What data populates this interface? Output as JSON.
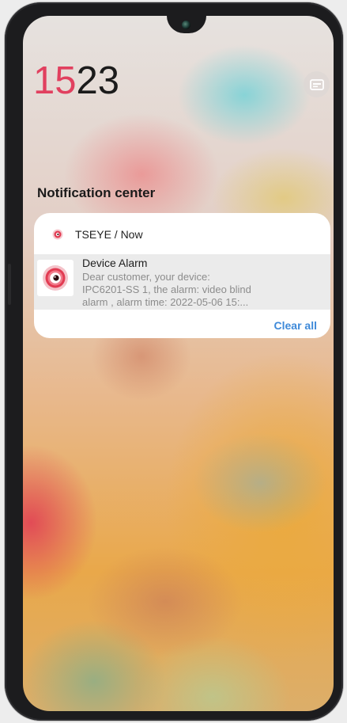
{
  "status": {
    "hour": "15",
    "minute": "23"
  },
  "notification_center": {
    "title": "Notification center",
    "clear_all_label": "Clear all"
  },
  "notification": {
    "app_name": "TSEYE",
    "time": "Now",
    "meta": "TSEYE / Now",
    "title": "Device Alarm",
    "lines": [
      "Dear customer, your device:",
      "IPC6201-SS 1, the alarm: video blind",
      "alarm , alarm time: 2022-05-06 15:..."
    ]
  },
  "icons": {
    "app_icon": "tseye-camera-icon",
    "message_icon": "message-icon",
    "camera": "front-camera"
  },
  "colors": {
    "hour": "#e1405f",
    "minute": "#1b1b1b",
    "accent_link": "#3f8ad9",
    "app_icon_red": "#e23b52"
  }
}
